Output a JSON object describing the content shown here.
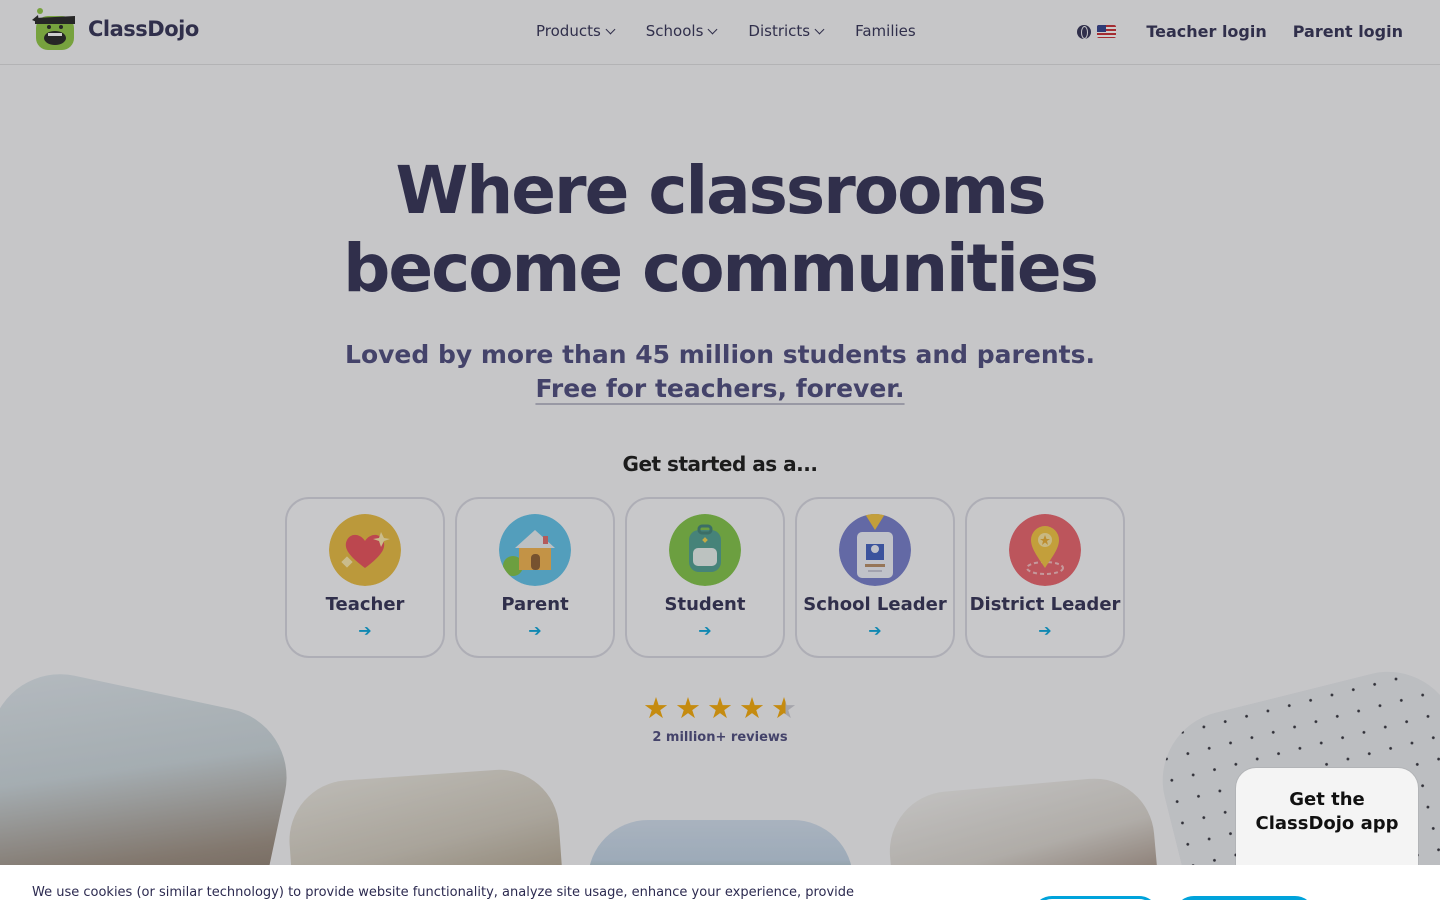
{
  "header": {
    "brand": "ClassDojo",
    "nav": [
      {
        "label": "Products"
      },
      {
        "label": "Schools"
      },
      {
        "label": "Districts"
      },
      {
        "label": "Families"
      }
    ],
    "teacher_login": "Teacher login",
    "parent_login": "Parent login"
  },
  "hero": {
    "title_line1": "Where classrooms",
    "title_line2": "become communities",
    "subtitle_line1": "Loved by more than 45 million students and parents.",
    "subtitle_line2": "Free for teachers, forever.",
    "get_started": "Get started as a..."
  },
  "roles": [
    {
      "label": "Teacher",
      "arrow": "➔",
      "color": "#e7b93a"
    },
    {
      "label": "Parent",
      "arrow": "➔",
      "color": "#5bc0e8"
    },
    {
      "label": "Student",
      "arrow": "➔",
      "color": "#7cc242"
    },
    {
      "label": "School Leader",
      "arrow": "➔",
      "color": "#7179c9"
    },
    {
      "label": "District Leader",
      "arrow": "➔",
      "color": "#e85e67"
    }
  ],
  "rating": {
    "stars": 4.5,
    "max": 5,
    "reviews": "2 million+ reviews"
  },
  "app_cta": {
    "line1": "Get the",
    "line2": "ClassDojo app"
  },
  "cookie": {
    "text": "We use cookies (or similar technology) to provide website functionality, analyze site usage, enhance your experience, provide"
  },
  "colors": {
    "brand_text": "#2c2a50",
    "accent": "#00a3db",
    "star": "#f5a700"
  }
}
